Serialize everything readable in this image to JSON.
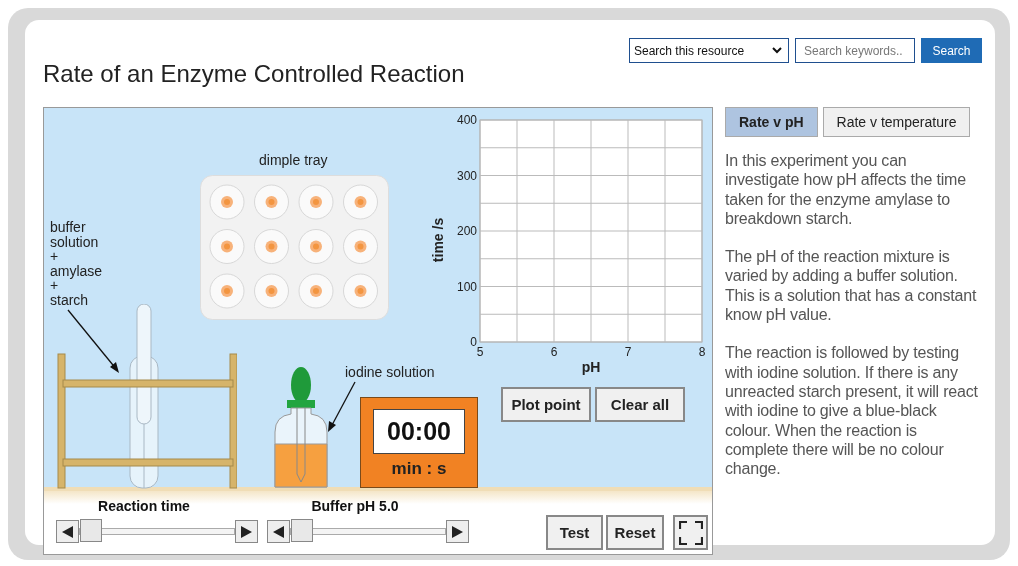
{
  "title": "Rate of an Enzyme Controlled Reaction",
  "search": {
    "scope": "Search this resource",
    "placeholder": "Search keywords..",
    "button": "Search"
  },
  "simulation": {
    "tray_label": "dimple tray",
    "tube_label": [
      "buffer",
      "solution",
      "+",
      "amylase",
      "+",
      "starch"
    ],
    "iodine_label": "iodine solution",
    "timer": {
      "value": "00:00",
      "units": "min : s"
    },
    "chart_data": {
      "type": "scatter",
      "grid": true,
      "xlabel": "pH",
      "ylabel": "time /s",
      "xlim": [
        5,
        8
      ],
      "ylim": [
        0,
        400
      ],
      "xticks": [
        5,
        6,
        7,
        8
      ],
      "yticks": [
        0,
        100,
        200,
        300,
        400
      ]
    },
    "chart_buttons": [
      "Plot point",
      "Clear all"
    ],
    "sliders": [
      {
        "label": "Reaction time",
        "level": 0
      },
      {
        "label": "Buffer pH 5.0",
        "level": 0
      }
    ],
    "buttons": [
      "Test",
      "Reset"
    ]
  },
  "tabs": [
    {
      "label": "Rate v pH",
      "selected": true
    },
    {
      "label": "Rate v temperature",
      "selected": false
    }
  ],
  "paragraphs": [
    "In this experiment you can investigate how pH affects the time taken for the enzyme amylase to breakdown starch.",
    "The pH of the reaction mixture is varied by adding a buffer solution. This is a solution that has a constant know pH value.",
    "The reaction is followed by testing with iodine solution. If there is any unreacted starch present, it will react with iodine to give a blue-black colour. When the reaction is complete there will be no colour change."
  ]
}
